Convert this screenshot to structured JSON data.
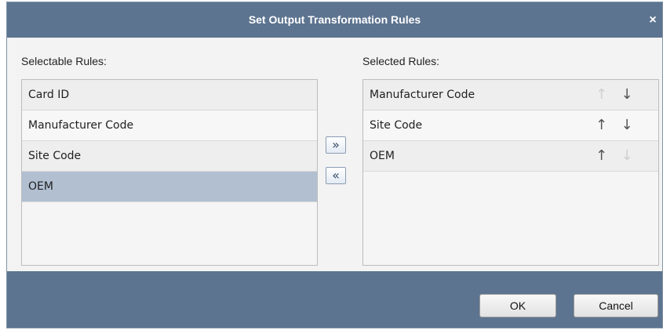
{
  "dialog": {
    "title": "Set Output Transformation Rules",
    "close_icon": "×"
  },
  "selectable": {
    "label": "Selectable Rules:",
    "items": [
      "Card ID",
      "Manufacturer Code",
      "Site Code",
      "OEM"
    ],
    "selected_item": "OEM"
  },
  "selected": {
    "label": "Selected Rules:",
    "items": [
      {
        "label": "Manufacturer Code",
        "up_enabled": false,
        "down_enabled": true
      },
      {
        "label": "Site Code",
        "up_enabled": true,
        "down_enabled": true
      },
      {
        "label": "OEM",
        "up_enabled": true,
        "down_enabled": false
      }
    ],
    "up_icon": "↑",
    "down_icon": "↓"
  },
  "move": {
    "add_icon": "»",
    "remove_icon": "«"
  },
  "footer": {
    "ok_label": "OK",
    "cancel_label": "Cancel"
  },
  "colors": {
    "titlebar": "#5d7490",
    "selected_row": "#b1bfd1"
  }
}
